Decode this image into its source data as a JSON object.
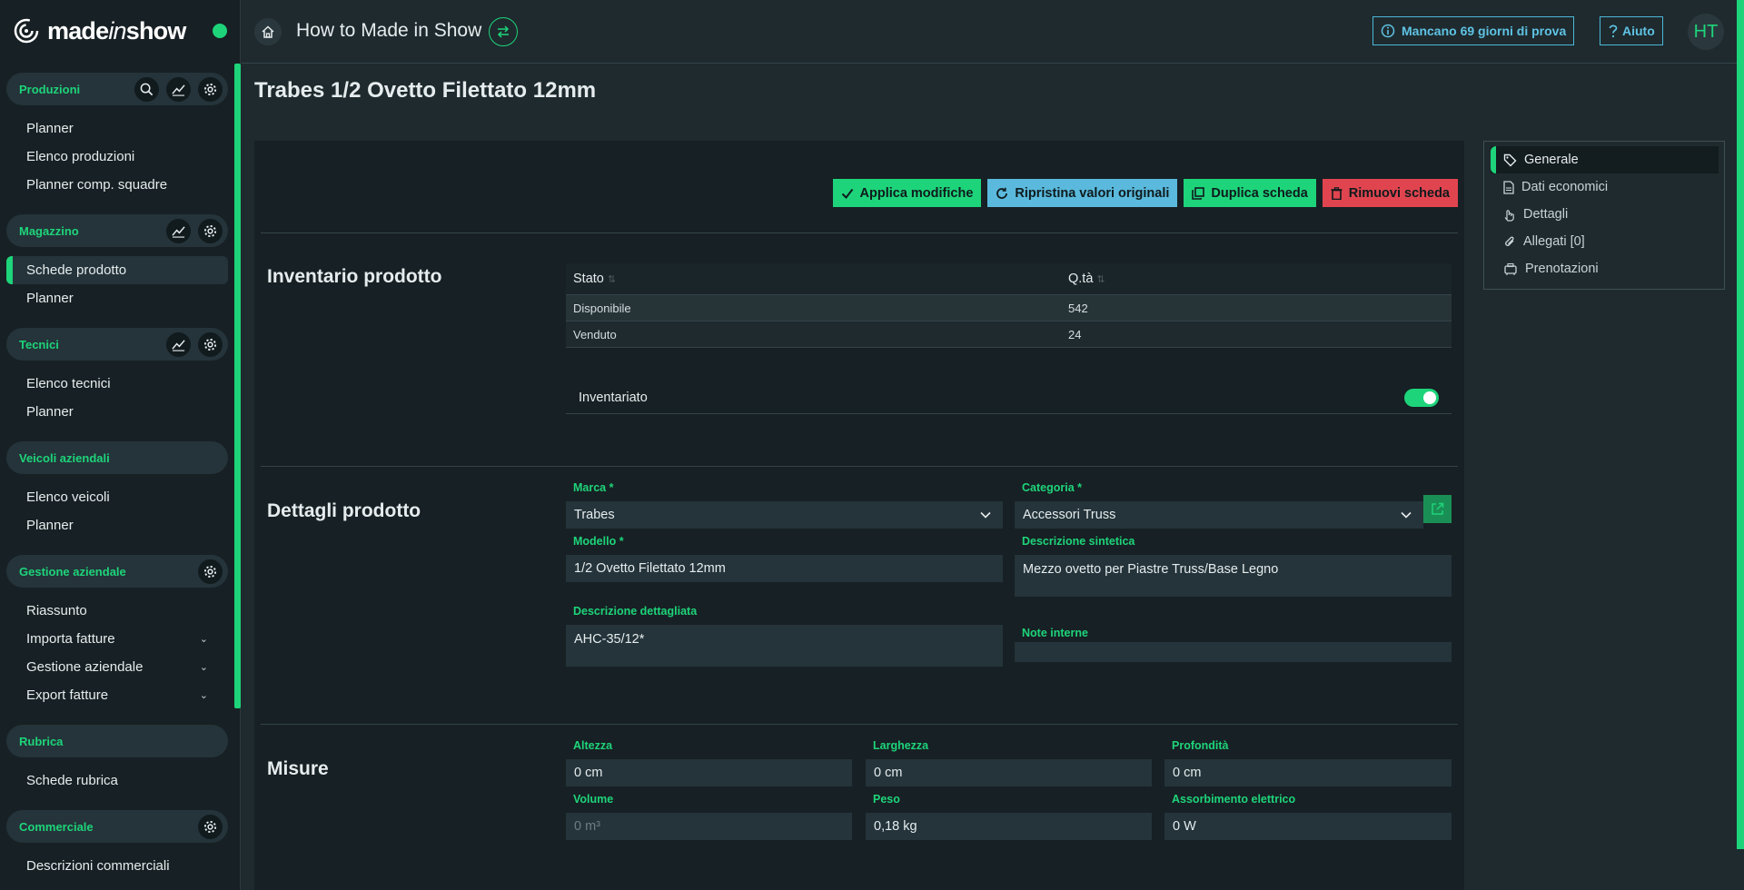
{
  "app": {
    "logo_text_a": "made",
    "logo_text_in": "in",
    "logo_text_b": "show",
    "accent_color": "#1ed47a",
    "info_color": "#5fc3e4",
    "danger_color": "#e0454f"
  },
  "topbar": {
    "title": "How to Made in Show",
    "trial_label": "Mancano 69 giorni di prova",
    "help_label": "Aiuto",
    "avatar_initials": "HT"
  },
  "sidebar": {
    "sections": [
      {
        "label": "Produzioni",
        "icons": [
          "search-icon",
          "chart-icon",
          "gear-icon"
        ],
        "items": [
          "Planner",
          "Elenco produzioni",
          "Planner comp. squadre"
        ]
      },
      {
        "label": "Magazzino",
        "icons": [
          "chart-icon",
          "gear-icon"
        ],
        "items": [
          "Schede prodotto",
          "Planner"
        ],
        "active_item": "Schede prodotto"
      },
      {
        "label": "Tecnici",
        "icons": [
          "chart-icon",
          "gear-icon"
        ],
        "items": [
          "Elenco tecnici",
          "Planner"
        ]
      },
      {
        "label": "Veicoli aziendali",
        "icons": [],
        "items": [
          "Elenco veicoli",
          "Planner"
        ]
      },
      {
        "label": "Gestione aziendale",
        "icons": [
          "gear-icon"
        ],
        "items": [
          "Riassunto",
          "Importa fatture",
          "Gestione aziendale",
          "Export fatture"
        ]
      },
      {
        "label": "Rubrica",
        "icons": [],
        "items": [
          "Schede rubrica"
        ]
      },
      {
        "label": "Commerciale",
        "icons": [
          "gear-icon"
        ],
        "items": [
          "Descrizioni commerciali"
        ]
      }
    ]
  },
  "page": {
    "title": "Trabes 1/2 Ovetto Filettato 12mm"
  },
  "actions": {
    "apply": "Applica modifiche",
    "reset": "Ripristina valori originali",
    "duplicate": "Duplica scheda",
    "remove": "Rimuovi scheda"
  },
  "inventory": {
    "title": "Inventario prodotto",
    "columns": [
      "Stato",
      "Q.tà"
    ],
    "rows": [
      {
        "stato": "Disponibile",
        "qta": "542"
      },
      {
        "stato": "Venduto",
        "qta": "24"
      }
    ],
    "toggle_label": "Inventariato",
    "toggle_on": true
  },
  "details": {
    "title": "Dettagli prodotto",
    "marca_label": "Marca *",
    "marca_value": "Trabes",
    "categoria_label": "Categoria *",
    "categoria_value": "Accessori Truss",
    "modello_label": "Modello *",
    "modello_value": "1/2 Ovetto Filettato 12mm",
    "desc_sint_label": "Descrizione sintetica",
    "desc_sint_value": "Mezzo ovetto per Piastre Truss/Base  Legno",
    "desc_dett_label": "Descrizione dettagliata",
    "desc_dett_value": "AHC-35/12*",
    "note_label": "Note interne",
    "note_value": ""
  },
  "measures": {
    "title": "Misure",
    "altezza_label": "Altezza",
    "altezza_value": "0 cm",
    "larghezza_label": "Larghezza",
    "larghezza_value": "0 cm",
    "profondita_label": "Profondità",
    "profondita_value": "0 cm",
    "volume_label": "Volume",
    "volume_value": "0 m³",
    "peso_label": "Peso",
    "peso_value": "0,18 kg",
    "assorb_label": "Assorbimento elettrico",
    "assorb_value": "0 W"
  },
  "side_nav": {
    "items": [
      {
        "label": "Generale",
        "icon": "tag-icon"
      },
      {
        "label": "Dati economici",
        "icon": "document-icon"
      },
      {
        "label": "Dettagli",
        "icon": "hand-icon"
      },
      {
        "label": "Allegati [0]",
        "icon": "paperclip-icon"
      },
      {
        "label": "Prenotazioni",
        "icon": "booking-icon"
      }
    ],
    "active": "Generale"
  }
}
